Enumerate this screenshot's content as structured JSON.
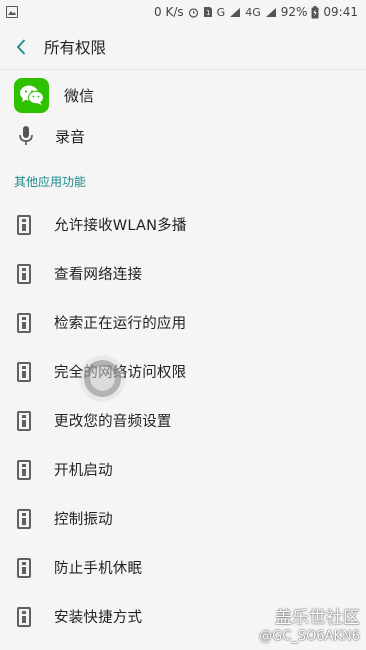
{
  "status_bar": {
    "net_speed": "0 K/s",
    "battery": "92%",
    "time": "09:41",
    "signal_label": "4G",
    "sim_label": "G"
  },
  "header": {
    "title": "所有权限"
  },
  "app": {
    "name": "微信",
    "logo_color": "#2dc100"
  },
  "permission": {
    "label": "录音",
    "icon": "microphone-icon"
  },
  "section": {
    "title": "其他应用功能",
    "accent": "#1b8a8a"
  },
  "items": [
    {
      "label": "允许接收WLAN多播",
      "icon": "info-icon"
    },
    {
      "label": "查看网络连接",
      "icon": "info-icon"
    },
    {
      "label": "检索正在运行的应用",
      "icon": "info-icon"
    },
    {
      "label": "完全的网络访问权限",
      "icon": "info-icon"
    },
    {
      "label": "更改您的音频设置",
      "icon": "info-icon"
    },
    {
      "label": "开机启动",
      "icon": "info-icon"
    },
    {
      "label": "控制振动",
      "icon": "info-icon"
    },
    {
      "label": "防止手机休眠",
      "icon": "info-icon"
    },
    {
      "label": "安装快捷方式",
      "icon": "info-icon"
    }
  ],
  "watermark": {
    "main": "盖乐世社区",
    "sub": "@GC_SO6AKN6"
  }
}
